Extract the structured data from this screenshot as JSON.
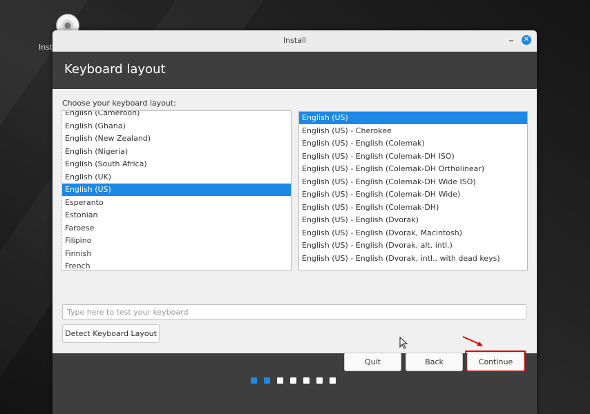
{
  "desktop": {
    "icon_label": "Inst"
  },
  "window": {
    "title": "Install",
    "minimize_icon": "minimize-icon",
    "close_icon": "close-icon"
  },
  "page": {
    "title": "Keyboard layout",
    "choose_label": "Choose your keyboard layout:"
  },
  "left_list": {
    "items": [
      "English (Cameroon)",
      "English (Ghana)",
      "English (New Zealand)",
      "English (Nigeria)",
      "English (South Africa)",
      "English (UK)",
      "English (US)",
      "Esperanto",
      "Estonian",
      "Faroese",
      "Filipino",
      "Finnish",
      "French"
    ],
    "selected_index": 6
  },
  "right_list": {
    "items": [
      "English (US)",
      "English (US) - Cherokee",
      "English (US) - English (Colemak)",
      "English (US) - English (Colemak-DH ISO)",
      "English (US) - English (Colemak-DH Ortholinear)",
      "English (US) - English (Colemak-DH Wide ISO)",
      "English (US) - English (Colemak-DH Wide)",
      "English (US) - English (Colemak-DH)",
      "English (US) - English (Dvorak)",
      "English (US) - English (Dvorak, Macintosh)",
      "English (US) - English (Dvorak, alt. intl.)",
      "English (US) - English (Dvorak, intl., with dead keys)"
    ],
    "selected_index": 0
  },
  "test_input": {
    "placeholder": "Type here to test your keyboard",
    "value": ""
  },
  "buttons": {
    "detect": "Detect Keyboard Layout",
    "quit": "Quit",
    "back": "Back",
    "continue": "Continue"
  },
  "progress": {
    "current_step": 2,
    "total_steps": 7
  },
  "colors": {
    "accent": "#1e88e5",
    "highlight": "#e00000"
  }
}
